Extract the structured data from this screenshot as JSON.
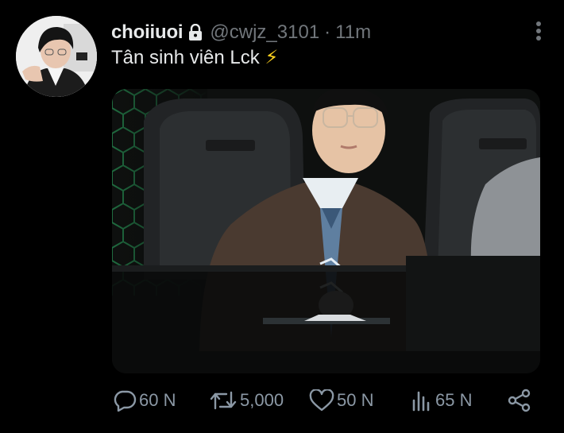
{
  "tweet": {
    "author": {
      "display_name": "choiiuoi",
      "protected_icon": "lock-icon",
      "handle": "@cwjz_3101",
      "separator": "·",
      "timestamp": "11m"
    },
    "text": "Tân sinh viên Lck",
    "emoji": "⚡",
    "more_icon": "more-vertical-icon",
    "media": {
      "type": "photo",
      "description_icon": "photo"
    },
    "actions": {
      "reply": {
        "icon": "reply-icon",
        "count": "60 N"
      },
      "retweet": {
        "icon": "retweet-icon",
        "count": "5,000"
      },
      "like": {
        "icon": "heart-icon",
        "count": "50 N"
      },
      "views": {
        "icon": "views-icon",
        "count": "65 N"
      },
      "share": {
        "icon": "share-icon"
      }
    }
  },
  "colors": {
    "background": "#000000",
    "primary_text": "#e7e9ea",
    "secondary_text": "#71767b",
    "action_gray": "#8b98a5",
    "emoji_yellow": "#ffd21f"
  }
}
